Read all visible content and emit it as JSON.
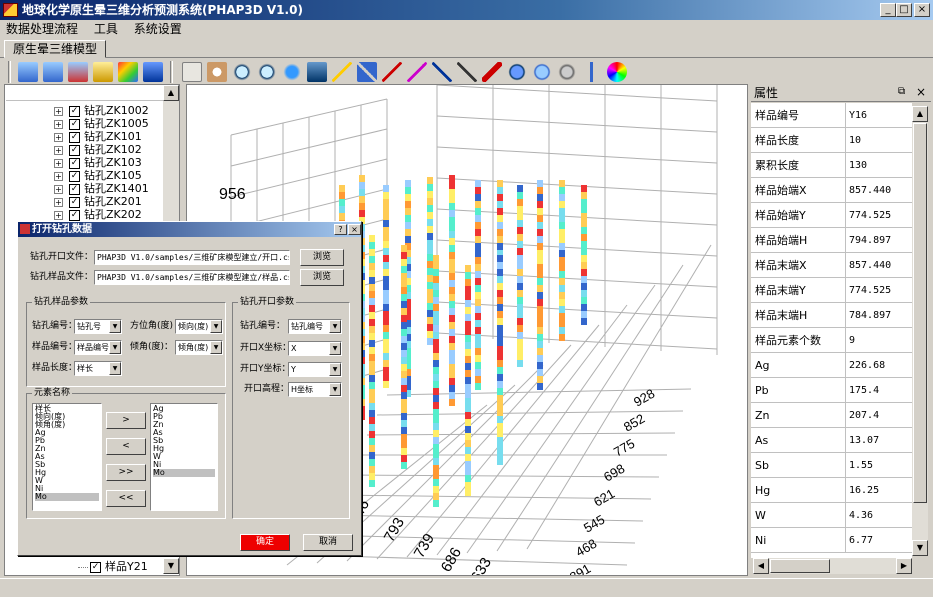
{
  "window": {
    "title": "地球化学原生晕三维分析预测系统(PHAP3D V1.0)",
    "min": "_",
    "max": "□",
    "close": "×"
  },
  "menu": [
    "数据处理流程",
    "工具",
    "系统设置"
  ],
  "tab": "原生晕三维模型",
  "tree": {
    "items": [
      "钻孔ZK1002",
      "钻孔ZK1005",
      "钻孔ZK101",
      "钻孔ZK102",
      "钻孔ZK103",
      "钻孔ZK105",
      "钻孔ZK1401",
      "钻孔ZK201",
      "钻孔ZK202"
    ],
    "bottom_item": "样品Y21"
  },
  "plot": {
    "z_tick": "956",
    "right_axis_ticks": [
      "928",
      "852",
      "775",
      "698",
      "621",
      "545",
      "468",
      "391"
    ],
    "bottom_axis_ticks": [
      "846",
      "793",
      "739",
      "686",
      "633"
    ]
  },
  "properties": {
    "title": "属性",
    "rows": [
      {
        "k": "样品编号",
        "v": "Y16"
      },
      {
        "k": "样品长度",
        "v": "10"
      },
      {
        "k": "累积长度",
        "v": "130"
      },
      {
        "k": "样品始端X",
        "v": "857.440"
      },
      {
        "k": "样品始端Y",
        "v": "774.525"
      },
      {
        "k": "样品始端H",
        "v": "794.897"
      },
      {
        "k": "样品末端X",
        "v": "857.440"
      },
      {
        "k": "样品末端Y",
        "v": "774.525"
      },
      {
        "k": "样品末端H",
        "v": "784.897"
      },
      {
        "k": "样品元素个数",
        "v": "9"
      },
      {
        "k": "Ag",
        "v": "226.68"
      },
      {
        "k": "Pb",
        "v": "175.4"
      },
      {
        "k": "Zn",
        "v": "207.4"
      },
      {
        "k": "As",
        "v": "13.07"
      },
      {
        "k": "Sb",
        "v": "1.55"
      },
      {
        "k": "Hg",
        "v": "16.25"
      },
      {
        "k": "W",
        "v": "4.36"
      },
      {
        "k": "Ni",
        "v": "6.77"
      }
    ]
  },
  "dialog": {
    "title": "打开钻孔数据",
    "help": "?",
    "close": "×",
    "open_file_label": "钻孔开口文件：",
    "open_file_value": "PHAP3D V1.0/samples/三维矿床模型建立/开口.csv",
    "sample_file_label": "钻孔样品文件：",
    "sample_file_value": "PHAP3D V1.0/samples/三维矿床模型建立/样品.csv",
    "browse": "浏览",
    "sample_params_title": "钻孔样品参数",
    "hole_no_label": "钻孔编号：",
    "hole_no_value": "钻孔号",
    "azimuth_label": "方位角(度)",
    "azimuth_value": "倾向(度)",
    "sample_no_label": "样品编号：",
    "sample_no_value": "样品编号",
    "dip_label": "倾角(度)：",
    "dip_value": "倾角(度)",
    "length_label": "样品长度：",
    "length_value": "样长",
    "open_params_title": "钻孔开口参数",
    "o_hole_label": "钻孔编号：",
    "o_hole_value": "钻孔编号",
    "ox_label": "开口X坐标：",
    "ox_value": "X",
    "oy_label": "开口Y坐标：",
    "oy_value": "Y",
    "oh_label": "开口高程：",
    "oh_value": "H坐标",
    "elements_title": "元素名称",
    "left_list": [
      "样长",
      "倾向(度)",
      "倾角(度)",
      "Ag",
      "Pb",
      "Zn",
      "As",
      "Sb",
      "Hg",
      "W",
      "Ni",
      "Mo"
    ],
    "right_list": [
      "Ag",
      "Pb",
      "Zn",
      "As",
      "Sb",
      "Hg",
      "W",
      "Ni",
      "Mo"
    ],
    "move_buttons": [
      ">",
      "<",
      ">>",
      "<<"
    ],
    "ok": "确定",
    "cancel": "取消"
  }
}
